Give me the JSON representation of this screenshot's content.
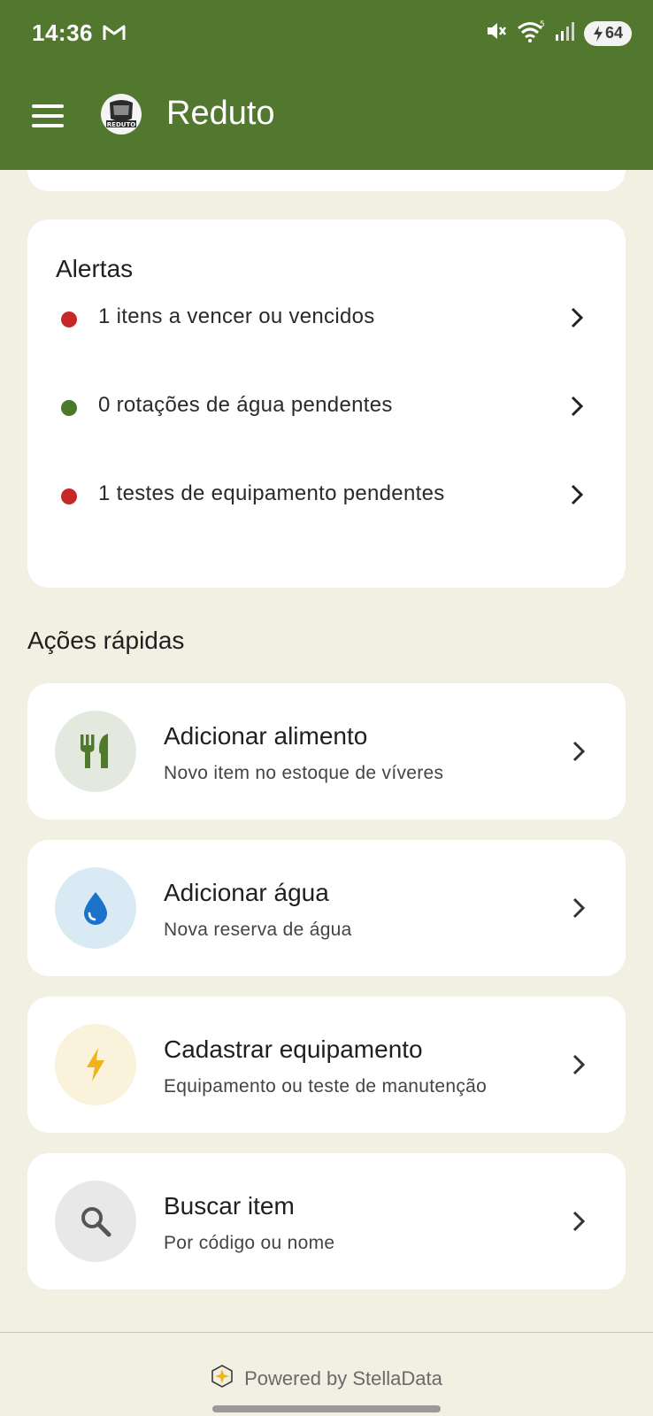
{
  "status_bar": {
    "time": "14:36",
    "battery": "64"
  },
  "app_bar": {
    "title": "Reduto",
    "logo_text": "REDUTO"
  },
  "alerts": {
    "title": "Alertas",
    "items": [
      {
        "text": "1 itens a vencer ou vencidos",
        "status_color": "#c62828"
      },
      {
        "text": "0 rotações de água pendentes",
        "status_color": "#4a7a29"
      },
      {
        "text": "1 testes de equipamento pendentes",
        "status_color": "#c62828"
      }
    ]
  },
  "quick_actions": {
    "title": "Ações rápidas",
    "items": [
      {
        "title": "Adicionar alimento",
        "subtitle": "Novo item no estoque de víveres",
        "icon": "fork-knife-icon",
        "icon_bg": "#e4e9df",
        "icon_color": "#4f7a2c"
      },
      {
        "title": "Adicionar água",
        "subtitle": "Nova reserva de água",
        "icon": "water-drop-icon",
        "icon_bg": "#d9eaf5",
        "icon_color": "#1a73c9"
      },
      {
        "title": "Cadastrar equipamento",
        "subtitle": "Equipamento ou teste de manutenção",
        "icon": "lightning-bolt-icon",
        "icon_bg": "#fbf2dc",
        "icon_color": "#f1b21a"
      },
      {
        "title": "Buscar item",
        "subtitle": "Por código ou nome",
        "icon": "search-icon",
        "icon_bg": "#e8e8e8",
        "icon_color": "#555555"
      }
    ]
  },
  "footer": {
    "powered_by": "Powered by StellaData"
  },
  "colors": {
    "primary": "#52772e",
    "background": "#f2efe3",
    "card": "#ffffff"
  }
}
